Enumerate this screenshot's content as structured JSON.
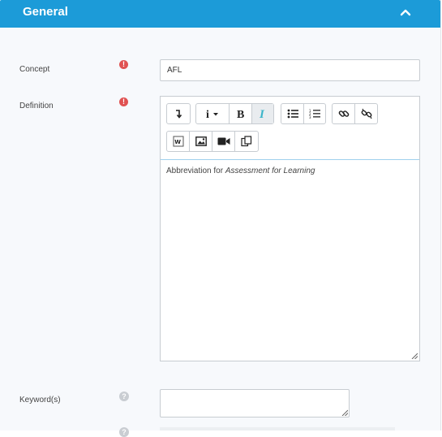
{
  "section": {
    "title": "General"
  },
  "fields": {
    "concept": {
      "label": "Concept",
      "value": "AFL"
    },
    "definition": {
      "label": "Definition",
      "text_plain": "Abbreviation for ",
      "text_italic": "Assessment for Learning"
    },
    "keywords": {
      "label": "Keyword(s)",
      "value": ""
    }
  },
  "icons": {
    "required": "exclamation-circle-icon",
    "help": "question-circle-icon"
  },
  "colors": {
    "header": "#1c9bd8",
    "required": "#e05252",
    "italic_active": "#3bb5c9"
  }
}
